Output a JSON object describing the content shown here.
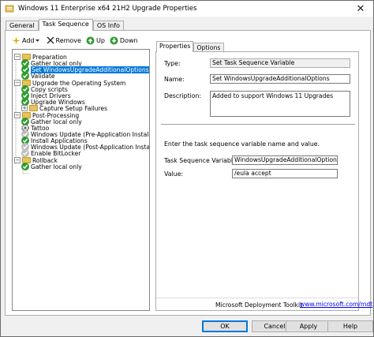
{
  "window": {
    "title": "Windows 11 Enterprise x64 21H2 Upgrade Properties",
    "close_glyph": "✕"
  },
  "tabs": [
    "General",
    "Task Sequence",
    "OS Info"
  ],
  "toolbar": {
    "add": "Add",
    "remove": "Remove",
    "up": "Up",
    "down": "Down"
  },
  "tree": [
    {
      "label": "Preparation",
      "icon": "folder",
      "expander": "−"
    },
    {
      "label": "Gather local only",
      "icon": "check-icon"
    },
    {
      "label": "Set WindowsUpgradeAdditionalOptions",
      "icon": "check-icon",
      "selected": true
    },
    {
      "label": "Validate",
      "icon": "check-icon"
    },
    {
      "label": "Upgrade the Operating System",
      "icon": "folder",
      "expander": "−"
    },
    {
      "label": "Copy scripts",
      "icon": "check-icon"
    },
    {
      "label": "Inject Drivers",
      "icon": "check-icon"
    },
    {
      "label": "Upgrade Windows",
      "icon": "check-icon"
    },
    {
      "label": "Capture Setup Failures",
      "icon": "folder",
      "expander": "+"
    },
    {
      "label": "Post-Processing",
      "icon": "folder",
      "expander": "−"
    },
    {
      "label": "Gather local only",
      "icon": "check-icon"
    },
    {
      "label": "Tattoo",
      "icon": "gear-icon"
    },
    {
      "label": "Windows Update (Pre-Application Installa",
      "icon": "gray-check-icon"
    },
    {
      "label": "Install Applications",
      "icon": "check-icon"
    },
    {
      "label": "Windows Update (Post-Application Installa",
      "icon": "gray-check-icon"
    },
    {
      "label": "Enable BitLocker",
      "icon": "gray-check-icon"
    },
    {
      "label": "Rollback",
      "icon": "folder",
      "expander": "−"
    },
    {
      "label": "Gather local only",
      "icon": "check-icon"
    }
  ],
  "right_tabs": [
    "Properties",
    "Options"
  ],
  "properties": {
    "type_label": "Type:",
    "type_value": "Set Task Sequence Variable",
    "name_label": "Name:",
    "name_value": "Set WindowsUpgradeAdditionalOptions",
    "description_label": "Description:",
    "description_value": "Added to support Windows 11 Upgrades",
    "instruction": "Enter the task sequence variable name and value.",
    "variable_label": "Task Sequence Variable:",
    "variable_value": "WindowsUpgradeAdditionalOptions",
    "value_label": "Value:",
    "value_value": "/eula accept"
  },
  "footer": {
    "toolkit": "Microsoft Deployment Toolkit",
    "link": "www.microsoft.com/mdt"
  },
  "buttons": {
    "ok": "OK",
    "cancel": "Cancel",
    "apply": "Apply",
    "help": "Help"
  }
}
